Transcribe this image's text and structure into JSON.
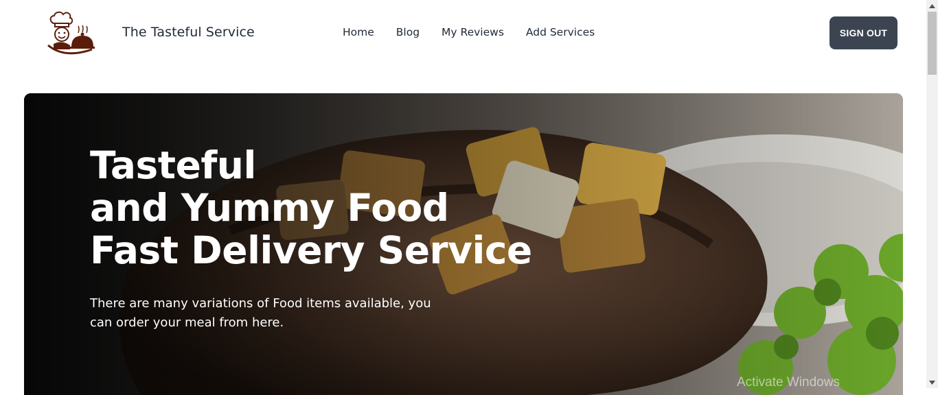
{
  "header": {
    "brand": "The Tasteful Service",
    "nav": [
      "Home",
      "Blog",
      "My Reviews",
      "Add Services"
    ],
    "signout_label": "SIGN OUT"
  },
  "hero": {
    "title_lines": [
      "Tasteful",
      "and Yummy Food",
      "Fast Delivery Service"
    ],
    "description": "There are many variations of Food items available, you can order your meal from here."
  },
  "watermark": "Activate Windows",
  "colors": {
    "signout_bg": "#3d4451",
    "text_dark": "#1f2937",
    "logo_brown": "#5b1d0a"
  },
  "icons": {
    "logo": "chef-logo-icon",
    "scroll_up": "chevron-up-icon",
    "scroll_down": "chevron-down-icon"
  }
}
